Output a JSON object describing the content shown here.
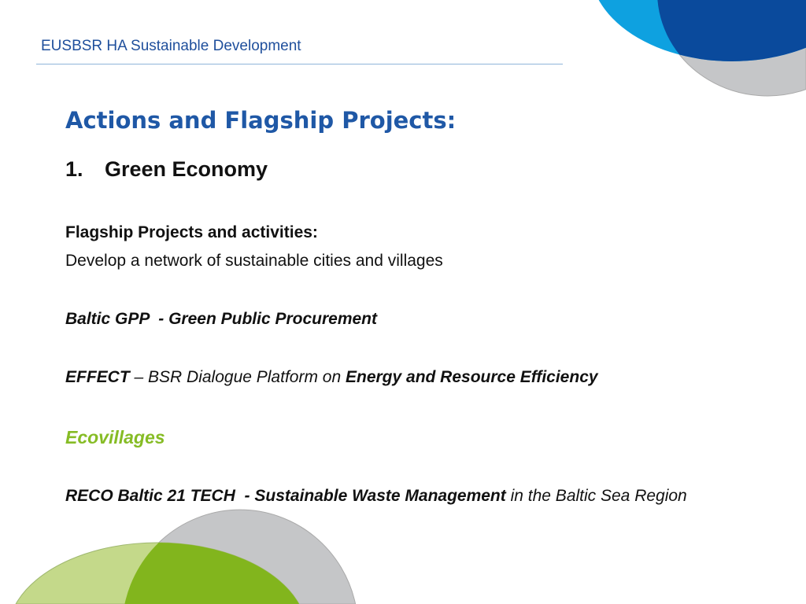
{
  "header": {
    "title": "EUSBSR HA Sustainable Development"
  },
  "slide": {
    "title": "Actions and Flagship Projects:",
    "section": {
      "number": "1.",
      "label": "Green Economy"
    },
    "flagship_heading": "Flagship Projects and activities:",
    "flagship_text": "Develop a network of sustainable cities and villages",
    "items": [
      {
        "bold": "Baltic GPP  - Green Public Procurement"
      },
      {
        "bold": "EFFECT",
        "mid": " – BSR Dialogue Platform on ",
        "bold2": "Energy and Resource Efficiency"
      },
      {
        "bold": "Ecovillages"
      },
      {
        "bold": "RECO Baltic 21 TECH  - Sustainable Waste Management",
        "tail": " in the Baltic Sea Region"
      }
    ]
  },
  "colors": {
    "light_blue": "#0ea1e0",
    "dark_blue": "#0a4a9c",
    "gray": "#c5c6c8",
    "light_green": "#c4d98a",
    "green": "#82b51d"
  }
}
